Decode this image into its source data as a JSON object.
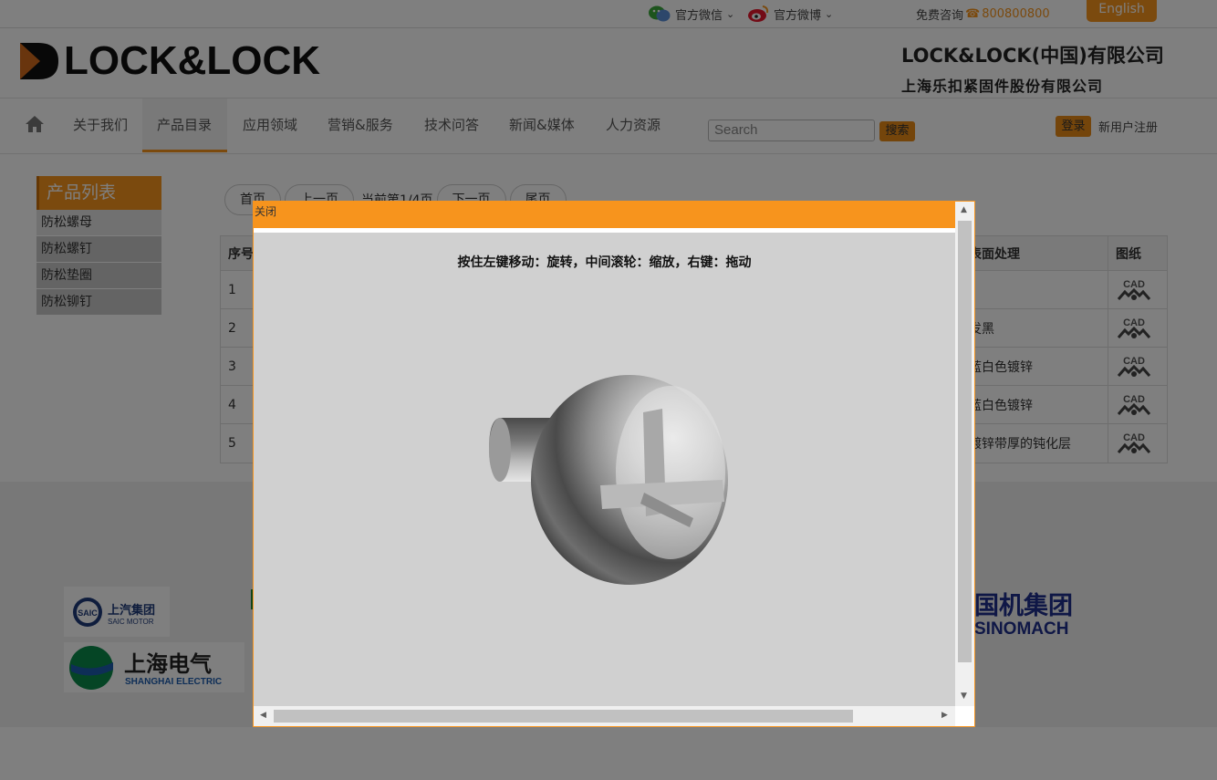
{
  "topbar": {
    "wechat_label": "官方微信",
    "weibo_label": "官方微博",
    "hotline_label": "免费咨询",
    "hotline_number": "800800800",
    "english_label": "English"
  },
  "header": {
    "logo_text": "LOCK&LOCK",
    "company_line1": "LOCK&LOCK(中国)有限公司",
    "company_line2": "上海乐扣紧固件股份有限公司"
  },
  "nav": {
    "items": [
      {
        "label": "关于我们"
      },
      {
        "label": "产品目录"
      },
      {
        "label": "应用领域"
      },
      {
        "label": "营销&服务"
      },
      {
        "label": "技术问答"
      },
      {
        "label": "新闻&媒体"
      },
      {
        "label": "人力资源"
      }
    ],
    "search_placeholder": "Search",
    "search_button": "搜索",
    "login_button": "登录",
    "register_link": "新用户注册"
  },
  "sidebar": {
    "title": "产品列表",
    "items": [
      {
        "label": "防松螺母"
      },
      {
        "label": "防松螺钉"
      },
      {
        "label": "防松垫圈"
      },
      {
        "label": "防松铆钉"
      }
    ]
  },
  "pager": {
    "first": "首页",
    "prev": "上一页",
    "info": "当前第1/4页",
    "next": "下一页",
    "last": "尾页"
  },
  "table": {
    "headers": {
      "no": "序号",
      "finish": "表面处理",
      "drawing": "图纸"
    },
    "rows": [
      {
        "no": "1",
        "finish": ""
      },
      {
        "no": "2",
        "finish": "发黑"
      },
      {
        "no": "3",
        "finish": "蓝白色镀锌"
      },
      {
        "no": "4",
        "finish": "蓝白色镀锌"
      },
      {
        "no": "5",
        "finish": "镀锌带厚的钝化层"
      }
    ],
    "cad_label": "CAD"
  },
  "modal": {
    "close_label": "关闭",
    "hint": "按住左键移动：旋转，中间滚轮：缩放，右键：拖动"
  },
  "partners": {
    "saic_cn": "上汽集团",
    "saic_en": "SAIC MOTOR",
    "saic_badge": "SAIC",
    "shel_cn": "上海电气",
    "shel_en": "SHANGHAI ELECTRIC",
    "sino_cn": "国机集团",
    "sino_en": "SINOMACH"
  },
  "colors": {
    "accent": "#f7941d",
    "overlay": "rgba(0,0,0,0.5)"
  }
}
